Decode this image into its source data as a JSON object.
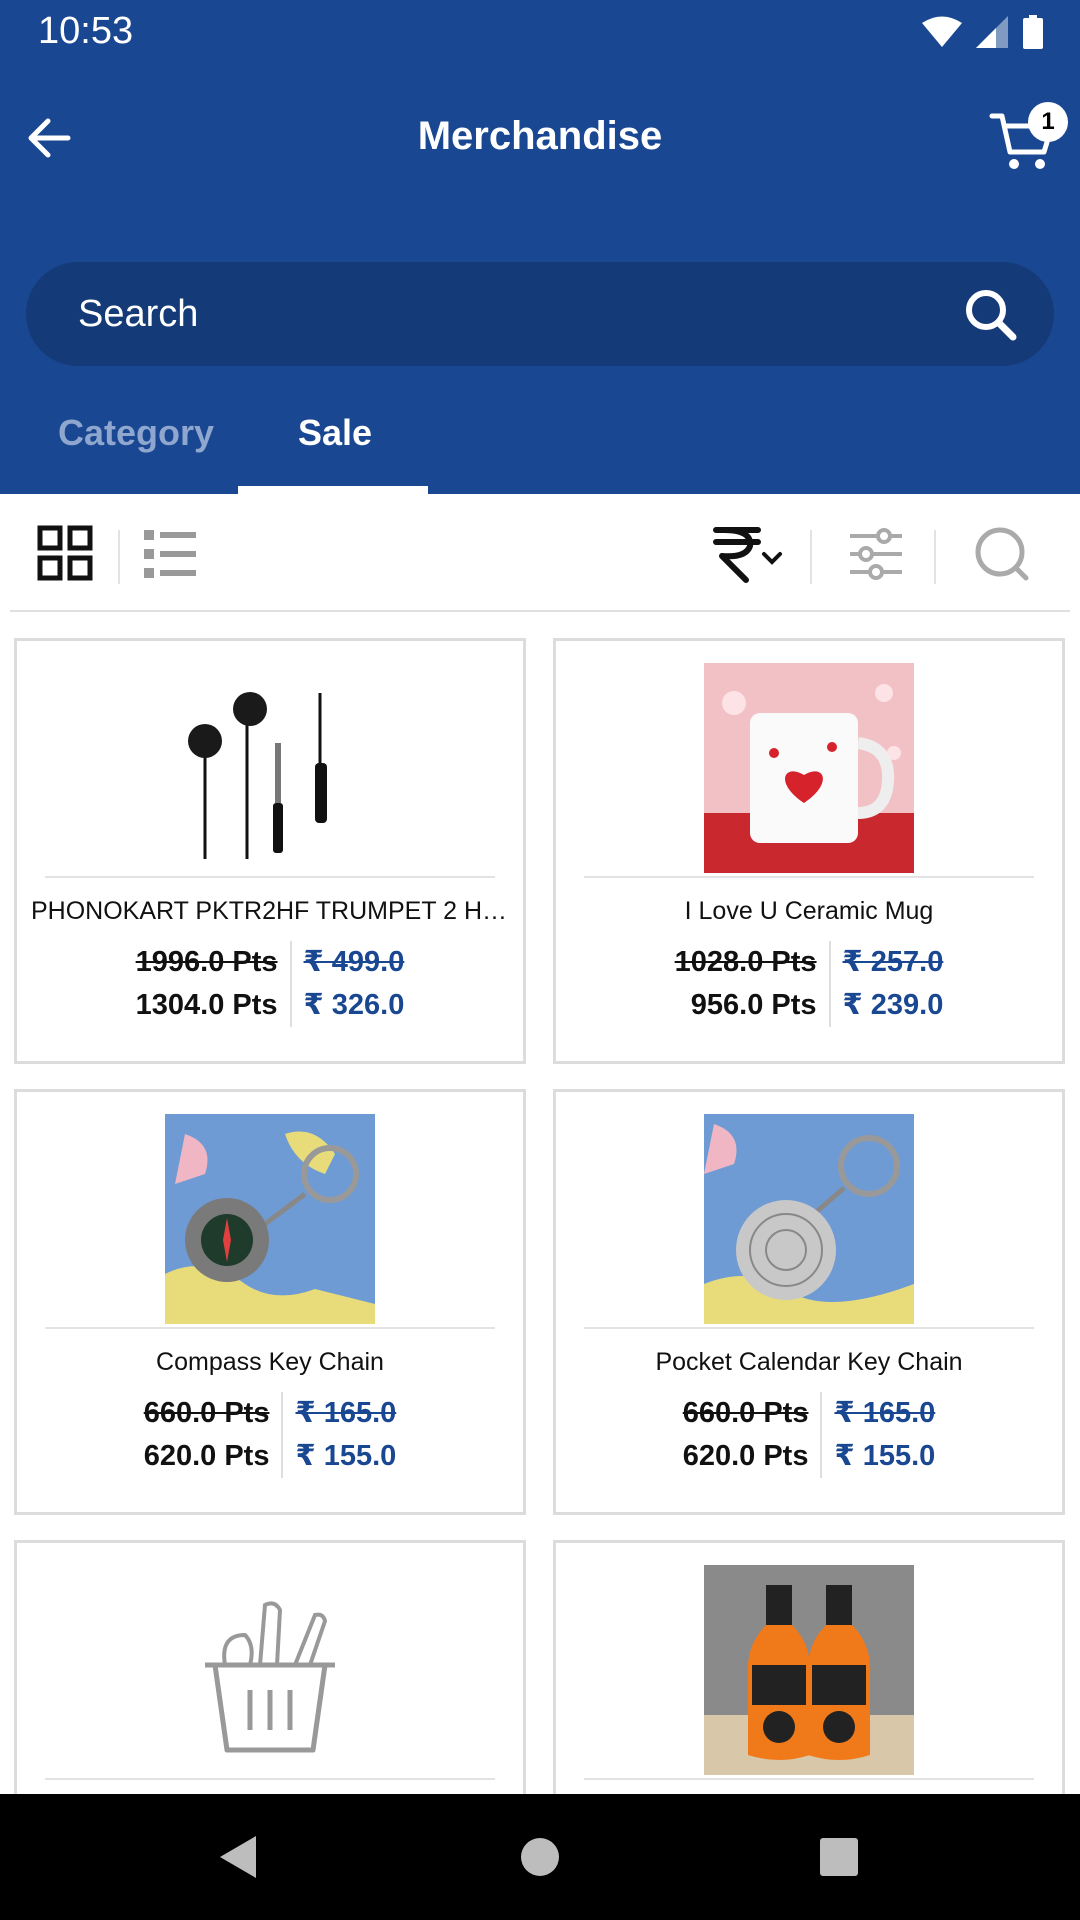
{
  "status_bar": {
    "time": "10:53"
  },
  "header": {
    "title": "Merchandise",
    "cart_count": "1"
  },
  "search": {
    "placeholder": "Search"
  },
  "tabs": [
    {
      "label": "Category",
      "active": false
    },
    {
      "label": "Sale",
      "active": true
    }
  ],
  "filter_bar": {
    "icons": [
      "grid-view-icon",
      "list-view-icon",
      "rupee-sort-icon",
      "sliders-filter-icon",
      "search-icon"
    ]
  },
  "products": [
    {
      "name": "PHONOKART PKTR2HF TRUMPET 2 HA...",
      "old_pts": "1996.0 Pts",
      "old_price": "₹ 499.0",
      "pts": "1304.0 Pts",
      "price": "₹ 326.0",
      "image": "earphones-image"
    },
    {
      "name": "I Love U Ceramic Mug",
      "old_pts": "1028.0 Pts",
      "old_price": "₹ 257.0",
      "pts": "956.0 Pts",
      "price": "₹ 239.0",
      "image": "mug-image"
    },
    {
      "name": "Compass Key Chain",
      "old_pts": "660.0 Pts",
      "old_price": "₹ 165.0",
      "pts": "620.0 Pts",
      "price": "₹ 155.0",
      "image": "compass-keychain-image"
    },
    {
      "name": "Pocket Calendar Key Chain",
      "old_pts": "660.0 Pts",
      "old_price": "₹ 165.0",
      "pts": "620.0 Pts",
      "price": "₹ 155.0",
      "image": "calendar-keychain-image"
    },
    {
      "name": "",
      "image": "placeholder-basket-image"
    },
    {
      "name": "",
      "image": "beer-bottles-image"
    }
  ],
  "colors": {
    "primary": "#1a4791",
    "price_blue": "#1a4791",
    "card_border": "#dcdcdc"
  }
}
